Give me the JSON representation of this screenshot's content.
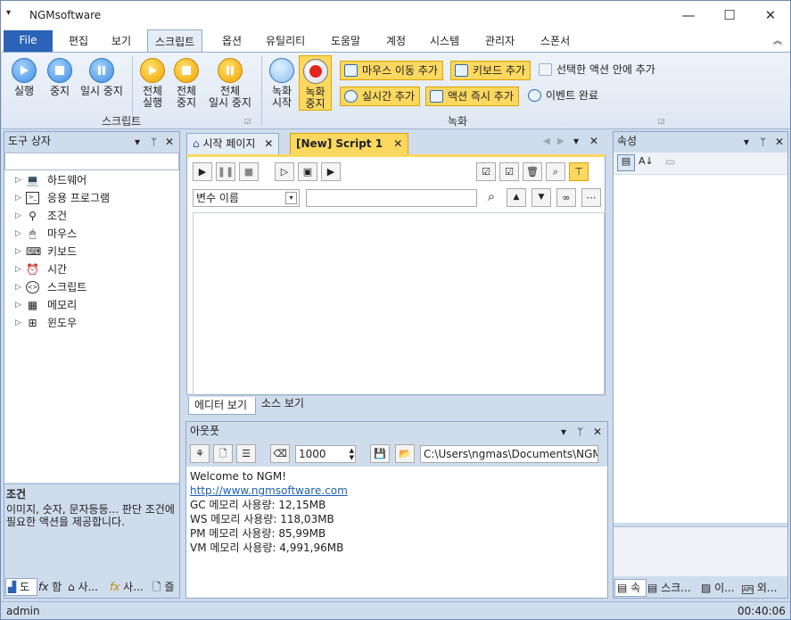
{
  "app": {
    "title": "NGMsoftware",
    "quick_access": "▾",
    "min": "—",
    "max": "☐",
    "close": "✕"
  },
  "menu": {
    "file": "File",
    "tabs": [
      "편집",
      "보기",
      "스크립트",
      "옵션",
      "유틸리티",
      "도움말",
      "계정",
      "시스템",
      "관리자",
      "스폰서"
    ],
    "selected": "스크립트",
    "collapse": "︽"
  },
  "ribbon": {
    "script_group": {
      "label": "스크립트",
      "run": "실행",
      "stop": "중지",
      "pause": "일시 중지",
      "run_all_1": "전체",
      "run_all_2": "실행",
      "stop_all_1": "전체",
      "stop_all_2": "중지",
      "pause_all_1": "전체",
      "pause_all_2": "일시 중지"
    },
    "record_group": {
      "label": "녹화",
      "rec_start_1": "녹화",
      "rec_start_2": "시작",
      "rec_stop_1": "녹화",
      "rec_stop_2": "중지",
      "add_mouse": "마우스 이동 추가",
      "add_keyboard": "키보드 추가",
      "add_in_selected": "선택한 액션 안에 추가",
      "add_realtime": "실시간 추가",
      "add_action_now": "액션 즉시 추가",
      "event_complete": "이벤트 완료"
    }
  },
  "toolbox": {
    "title": "도구 상자",
    "items": [
      "하드웨어",
      "응용 프로그램",
      "조건",
      "마우스",
      "키보드",
      "시간",
      "스크립트",
      "메모리",
      "윈도우"
    ],
    "info_title": "조건",
    "info_text": "이미지, 숫자, 문자등등... 판단 조건에 필요한 액션을 제공합니다.",
    "bottom_tabs": [
      "도",
      "함",
      "사...",
      "사...",
      "즐"
    ]
  },
  "document": {
    "tabs": [
      "시작 페이지",
      "[New] Script 1"
    ],
    "variable_select": "변수 이름",
    "bottom_tabs": [
      "에디터 보기",
      "소스 보기"
    ]
  },
  "output": {
    "title": "아웃풋",
    "count": "1000",
    "path": "C:\\Users\\ngmas\\Documents\\NGM6\\",
    "lines": [
      "Welcome to NGM!",
      "http://www.ngmsoftware.com",
      "GC 메모리 사용량: 12,15MB",
      "WS 메모리 사용량: 118,03MB",
      "PM 메모리 사용량: 85,99MB",
      "VM 메모리 사용량: 4,991,96MB"
    ]
  },
  "properties": {
    "title": "속성",
    "bottom_tabs": [
      "속",
      "스크...",
      "이...",
      "외..."
    ]
  },
  "status": {
    "user": "admin",
    "time": "00:40:06"
  },
  "colors": {
    "accent": "#2b63b8",
    "highlight": "#fbd860",
    "panel_header": "#cfdcec"
  }
}
